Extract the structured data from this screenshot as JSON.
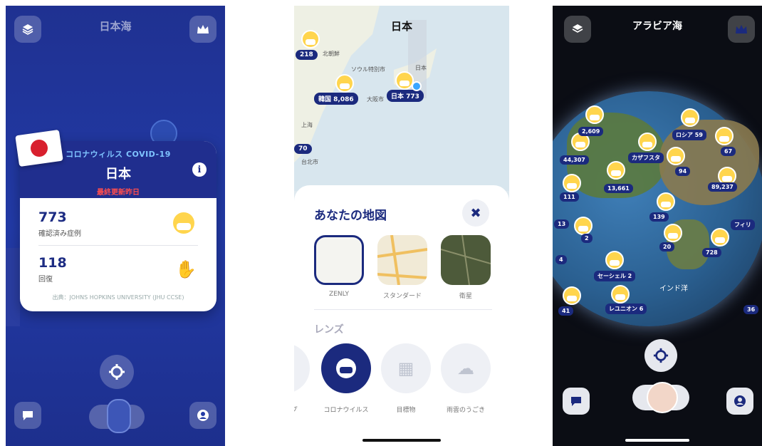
{
  "screen1": {
    "region_title": "日本海",
    "card": {
      "subtitle": "コロナウィルス COVID-19",
      "country": "日本",
      "updated": "最終更新昨日",
      "confirmed_value": "773",
      "confirmed_label": "確認済み症例",
      "recovered_value": "118",
      "recovered_label": "回復",
      "source": "出典：JOHNS HOPKINS UNIVERSITY (JHU CCSE)"
    }
  },
  "screen2": {
    "map_title": "日本",
    "map_labels": [
      "218",
      "北朝鮮",
      "ソウル特別市",
      "日本",
      "大阪市",
      "上海",
      "台北市",
      "70",
      "韓国 8,086",
      "日本 773"
    ],
    "sheet_title": "あなたの地図",
    "map_styles": [
      "ZENLY",
      "スタンダード",
      "衛星"
    ],
    "lens_title": "レンズ",
    "lenses": [
      "コロナウイルス",
      "目標物",
      "雨雲のうごき"
    ],
    "partial_lens_label": "プ"
  },
  "screen3": {
    "region_title": "アラビア海",
    "tags": [
      "2,609",
      "ロシア 59",
      "67",
      "44,307",
      "カザフスタ",
      "94",
      "89,237",
      "111",
      "13,661",
      "139",
      "13",
      "フィリ",
      "2",
      "20",
      "728",
      "4",
      "セーシェル 2",
      "41",
      "レユニオン 6",
      "36"
    ],
    "ocean_label": "インド洋"
  }
}
